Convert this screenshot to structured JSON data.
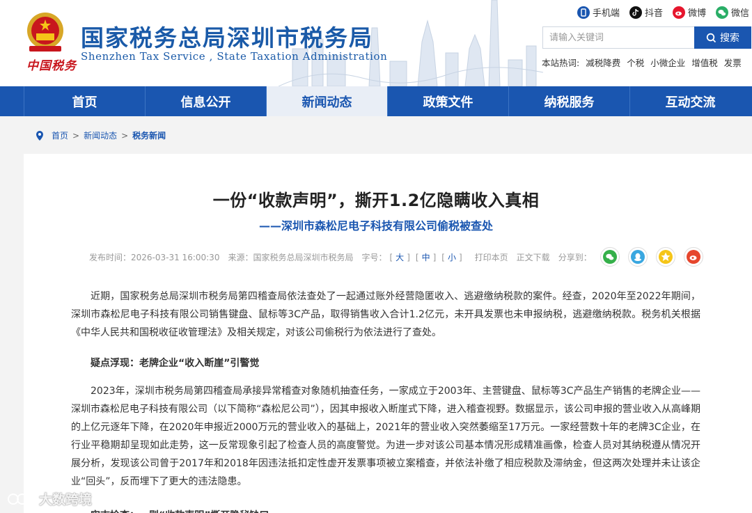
{
  "header": {
    "title": "国家税务总局深圳市税务局",
    "subtitle": "Shenzhen Tax Service , State Taxation Administration",
    "logo_caption": "中国税务"
  },
  "social": [
    {
      "label": "手机端",
      "icon": "mobile-icon",
      "color": "#1a56b0"
    },
    {
      "label": "抖音",
      "icon": "douyin-icon",
      "color": "#111111"
    },
    {
      "label": "微博",
      "icon": "weibo-icon",
      "color": "#e6162d"
    },
    {
      "label": "微信",
      "icon": "wechat-icon",
      "color": "#2aae67"
    }
  ],
  "search": {
    "placeholder": "请输入关键词",
    "button_label": "搜索"
  },
  "hot": {
    "label": "本站热词:",
    "items": [
      "减税降费",
      "个税",
      "小微企业",
      "增值税",
      "发票"
    ]
  },
  "nav": {
    "items": [
      "首页",
      "信息公开",
      "新闻动态",
      "政策文件",
      "纳税服务",
      "互动交流"
    ],
    "active": "新闻动态"
  },
  "breadcrumb": [
    "首页",
    "新闻动态",
    "税务新闻"
  ],
  "article": {
    "title": "一份“收款声明”，撕开1.2亿隐瞒收入真相",
    "subtitle": "——深圳市森松尼电子科技有限公司偷税被查处",
    "meta": {
      "publish_time": "发布时间：2026-03-31 16:00:30",
      "source": "来源：国家税务总局深圳市税务局",
      "font_label": "字号：",
      "font_large": "大",
      "font_medium": "中",
      "font_small": "小",
      "print": "打印本页",
      "download": "正文下载",
      "share": "分享到："
    },
    "paragraphs": [
      "近期，国家税务总局深圳市税务局第四稽查局依法查处了一起通过账外经营隐匿收入、逃避缴纳税款的案件。经查，2020年至2022年期间，深圳市森松尼电子科技有限公司销售键盘、鼠标等3C产品，取得销售收入合计1.2亿元，未开具发票也未申报纳税，逃避缴纳税款。税务机关根据《中华人民共和国税收征收管理法》及相关规定，对该公司偷税行为依法进行了查处。",
      "疑点浮现：老牌企业“收入断崖”引警觉",
      "2023年，深圳市税务局第四稽查局承接异常稽查对象随机抽查任务，一家成立于2003年、主营键盘、鼠标等3C产品生产销售的老牌企业——深圳市森松尼电子科技有限公司（以下简称“森松尼公司”），因其申报收入断崖式下降，进入稽查视野。数据显示，该公司申报的营业收入从高峰期的上亿元逐年下降，在2020年申报近2000万元的营业收入的基础上，2021年的营业收入突然萎缩至17万元。一家经营数十年的老牌3C企业，在行业平稳期却呈现如此走势，这一反常现象引起了检查人员的高度警觉。为进一步对该公司基本情况形成精准画像，检查人员对其纳税遵从情况开展分析，发现该公司曾于2017年和2018年因违法抵扣定性虚开发票事项被立案稽查，并依法补缴了相应税款及滞纳金，但这两次处理并未让该企业“回头”，反而埋下了更大的违法隐患。",
      "实志检查：一则“收款声明”撕开隐秘缺口"
    ]
  },
  "watermark": "大数跨境"
}
